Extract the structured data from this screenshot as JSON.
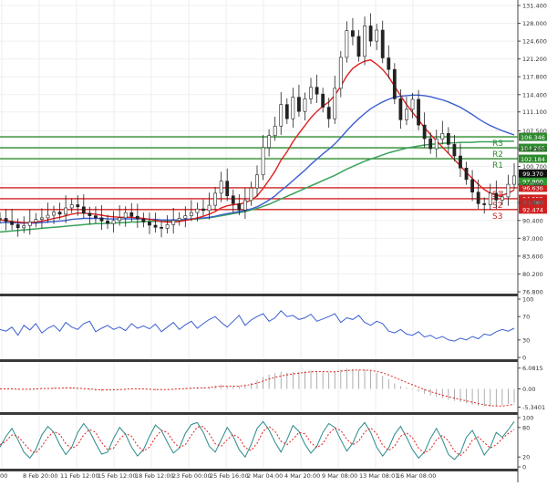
{
  "chart_data": {
    "type": "line",
    "price_axis": {
      "ticks": [
        "131.400",
        "128.000",
        "124.600",
        "121.200",
        "117.800",
        "114.400",
        "111.100",
        "107.500",
        "104.000",
        "100.700",
        "97.300",
        "93.800",
        "90.400",
        "87.000",
        "83.600",
        "80.200",
        "76.800"
      ],
      "tick_values": [
        131.4,
        128.0,
        124.6,
        121.2,
        117.8,
        114.4,
        111.1,
        107.5,
        104.0,
        100.7,
        97.3,
        93.8,
        90.4,
        87.0,
        83.6,
        80.2,
        76.8
      ],
      "ylim": [
        76.8,
        131.4
      ]
    },
    "time_axis": {
      "ticks": [
        "00",
        "8 Feb 20:00",
        "11 Feb 12:00",
        "15 Feb 12:00",
        "18 Feb 12:00",
        "23 Feb 00:00",
        "25 Feb 16:00",
        "2 Mar 04:00",
        "4 Mar 20:00",
        "9 Mar 08:00",
        "13 Mar 08:01",
        "16 Mar 08:00"
      ]
    },
    "levels": {
      "resistance": [
        {
          "label": "R3",
          "value": 106.346,
          "value_text": "106.346"
        },
        {
          "label": "R2",
          "value": 104.265,
          "value_text": "104.265"
        },
        {
          "label": "R1",
          "value": 102.184,
          "value_text": "102.184"
        }
      ],
      "support": [
        {
          "label": "S1",
          "value": 96.636,
          "value_text": "96.636"
        },
        {
          "label": "S2",
          "value": 94.555,
          "value_text": "94.555"
        },
        {
          "label": "S3",
          "value": 92.474,
          "value_text": "92.474"
        }
      ],
      "other_labels": [
        {
          "value": 98.0,
          "value_text": "98.370",
          "color": "#1f4fd6"
        },
        {
          "value": 93.9,
          "value_text": "93.880",
          "color": "#cc2020"
        },
        {
          "value": 97.9,
          "value_text": "97.900",
          "color": "#2f9a2f"
        }
      ],
      "current_price": {
        "value": 99.37,
        "value_text": "99.370"
      }
    },
    "price_series": {
      "close": [
        90.8,
        90.2,
        89.6,
        89.0,
        89.4,
        90.1,
        90.6,
        90.9,
        91.4,
        92.0,
        91.6,
        92.8,
        93.4,
        93.0,
        91.8,
        91.3,
        90.9,
        90.3,
        89.8,
        90.4,
        90.9,
        91.9,
        91.2,
        90.7,
        90.1,
        89.5,
        89.1,
        88.9,
        89.6,
        90.4,
        90.8,
        91.3,
        91.9,
        92.6,
        92.3,
        93.3,
        95.6,
        97.9,
        95.1,
        93.6,
        92.4,
        94.2,
        96.6,
        99.1,
        104.3,
        106.6,
        108.4,
        112.5,
        109.8,
        113.9,
        111.2,
        113.6,
        115.8,
        114.5,
        112.0,
        109.8,
        115.6,
        121.5,
        126.6,
        125.5,
        121.7,
        127.5,
        124.6,
        126.7,
        121.4,
        119.2,
        113.6,
        109.6,
        111.6,
        113.5,
        108.6,
        106.0,
        104.1,
        105.9,
        107.0,
        104.9,
        102.7,
        100.4,
        98.2,
        95.8,
        93.6,
        93.4,
        95.6,
        94.3,
        94.9,
        97.3,
        98.9
      ],
      "ma_fast_red": [
        90.5,
        90.4,
        90.2,
        90.1,
        90.0,
        90.0,
        90.1,
        90.3,
        90.5,
        90.8,
        91.0,
        91.3,
        91.6,
        91.8,
        91.8,
        91.7,
        91.6,
        91.4,
        91.2,
        91.1,
        91.0,
        91.0,
        91.0,
        90.9,
        90.8,
        90.6,
        90.4,
        90.2,
        90.1,
        90.1,
        90.2,
        90.4,
        90.6,
        90.9,
        91.2,
        91.6,
        92.1,
        92.8,
        93.2,
        93.4,
        93.5,
        93.8,
        94.3,
        95.1,
        96.5,
        98.1,
        99.8,
        101.9,
        103.5,
        105.4,
        107.0,
        108.5,
        110.0,
        111.2,
        112.2,
        113.0,
        114.3,
        116.0,
        118.0,
        119.4,
        120.2,
        120.8,
        121.0,
        120.2,
        119.2,
        117.8,
        116.0,
        114.2,
        112.5,
        111.0,
        109.6,
        108.1,
        106.8,
        105.6,
        104.4,
        103.2,
        102.0,
        100.8,
        99.6,
        98.4,
        97.3,
        96.3,
        95.6,
        95.2,
        95.2,
        95.6,
        96.2
      ],
      "ma_mid_blue": [
        90.0,
        90.0,
        90.0,
        89.9,
        89.9,
        89.9,
        89.9,
        90.0,
        90.1,
        90.2,
        90.3,
        90.4,
        90.6,
        90.7,
        90.8,
        90.8,
        90.8,
        90.8,
        90.7,
        90.7,
        90.7,
        90.7,
        90.7,
        90.7,
        90.7,
        90.6,
        90.6,
        90.5,
        90.5,
        90.5,
        90.5,
        90.6,
        90.7,
        90.8,
        90.9,
        91.0,
        91.2,
        91.5,
        91.7,
        91.9,
        92.1,
        92.3,
        92.6,
        93.0,
        93.6,
        94.3,
        95.1,
        96.1,
        97.0,
        98.0,
        99.0,
        100.0,
        101.1,
        102.1,
        103.1,
        104.0,
        105.0,
        106.2,
        107.5,
        108.7,
        109.8,
        110.8,
        111.7,
        112.4,
        113.0,
        113.5,
        113.9,
        114.1,
        114.2,
        114.3,
        114.3,
        114.2,
        114.0,
        113.7,
        113.4,
        113.0,
        112.5,
        112.0,
        111.3,
        110.6,
        109.8,
        109.1,
        108.5,
        108.0,
        107.5,
        107.1,
        106.7
      ],
      "ma_slow_green": [
        88.2,
        88.3,
        88.4,
        88.5,
        88.6,
        88.7,
        88.8,
        88.9,
        89.0,
        89.1,
        89.2,
        89.3,
        89.4,
        89.5,
        89.6,
        89.7,
        89.8,
        89.8,
        89.9,
        89.9,
        90.0,
        90.0,
        90.1,
        90.1,
        90.2,
        90.2,
        90.2,
        90.3,
        90.3,
        90.4,
        90.4,
        90.5,
        90.6,
        90.7,
        90.8,
        90.9,
        91.1,
        91.3,
        91.5,
        91.7,
        91.9,
        92.1,
        92.4,
        92.7,
        93.1,
        93.5,
        94.0,
        94.5,
        95.0,
        95.5,
        96.0,
        96.5,
        97.0,
        97.5,
        98.0,
        98.5,
        99.0,
        99.6,
        100.2,
        100.7,
        101.2,
        101.7,
        102.1,
        102.5,
        102.9,
        103.3,
        103.6,
        103.9,
        104.2,
        104.4,
        104.6,
        104.8,
        104.9,
        105.0,
        105.1,
        105.2,
        105.2,
        105.3,
        105.3,
        105.3,
        105.4,
        105.4,
        105.4,
        105.4,
        105.5,
        105.5,
        105.5
      ]
    },
    "rsi": {
      "ticks": [
        "100",
        "70",
        "30",
        "0"
      ],
      "tick_values": [
        100,
        70,
        30,
        0
      ],
      "values": [
        48,
        45,
        52,
        38,
        55,
        47,
        58,
        42,
        50,
        55,
        45,
        60,
        52,
        48,
        58,
        62,
        44,
        50,
        55,
        48,
        52,
        46,
        58,
        50,
        54,
        49,
        57,
        44,
        52,
        60,
        48,
        56,
        62,
        50,
        58,
        65,
        70,
        60,
        52,
        62,
        72,
        55,
        64,
        70,
        75,
        62,
        68,
        80,
        70,
        72,
        65,
        68,
        74,
        62,
        66,
        70,
        75,
        60,
        68,
        65,
        72,
        60,
        55,
        62,
        58,
        45,
        42,
        48,
        40,
        38,
        44,
        35,
        38,
        32,
        36,
        30,
        28,
        33,
        30,
        36,
        32,
        40,
        38,
        44,
        48,
        45,
        50
      ],
      "ylim": [
        0,
        100
      ]
    },
    "macd": {
      "ticks": [
        "6.0815",
        "0.00",
        "-5.3401"
      ],
      "tick_values": [
        6.0815,
        0.0,
        -5.3401
      ],
      "hist": [
        0.0,
        0.1,
        -0.2,
        -0.3,
        -0.2,
        -0.1,
        0.1,
        0.3,
        0.2,
        0.4,
        0.2,
        0.5,
        0.4,
        0.1,
        -0.2,
        -0.4,
        -0.5,
        -0.6,
        -0.4,
        -0.3,
        -0.1,
        0.1,
        0.2,
        0.1,
        -0.1,
        -0.2,
        -0.4,
        -0.3,
        -0.1,
        0.1,
        0.2,
        0.3,
        0.4,
        0.5,
        0.4,
        0.6,
        1.0,
        1.2,
        0.9,
        0.8,
        0.9,
        1.3,
        1.8,
        2.5,
        3.5,
        4.2,
        4.6,
        5.0,
        4.8,
        4.9,
        5.0,
        5.2,
        5.4,
        5.2,
        5.0,
        4.8,
        5.2,
        5.6,
        5.9,
        5.8,
        5.5,
        5.6,
        5.2,
        4.6,
        3.8,
        2.8,
        1.6,
        0.8,
        0.3,
        -0.2,
        -0.8,
        -1.4,
        -1.9,
        -2.3,
        -2.7,
        -3.1,
        -3.5,
        -3.9,
        -4.2,
        -4.6,
        -4.9,
        -5.1,
        -5.2,
        -5.0,
        -4.8,
        -4.4,
        -4.0
      ],
      "signal": [
        0.0,
        0.0,
        0.0,
        -0.1,
        -0.1,
        -0.1,
        0.0,
        0.1,
        0.1,
        0.2,
        0.2,
        0.3,
        0.3,
        0.2,
        0.1,
        0.0,
        -0.2,
        -0.3,
        -0.3,
        -0.3,
        -0.2,
        -0.1,
        0.0,
        0.0,
        0.0,
        -0.1,
        -0.2,
        -0.2,
        -0.2,
        -0.1,
        0.0,
        0.1,
        0.2,
        0.3,
        0.3,
        0.4,
        0.6,
        0.8,
        0.8,
        0.8,
        0.8,
        1.0,
        1.3,
        1.7,
        2.3,
        2.9,
        3.4,
        3.8,
        4.1,
        4.4,
        4.6,
        4.8,
        5.0,
        5.1,
        5.1,
        5.0,
        5.0,
        5.2,
        5.4,
        5.5,
        5.5,
        5.5,
        5.4,
        5.1,
        4.7,
        4.1,
        3.4,
        2.6,
        1.9,
        1.2,
        0.5,
        -0.2,
        -0.8,
        -1.3,
        -1.8,
        -2.3,
        -2.7,
        -3.1,
        -3.5,
        -3.9,
        -4.3,
        -4.6,
        -4.9,
        -5.0,
        -5.0,
        -4.8,
        -4.5
      ],
      "ylim": [
        -6.0,
        6.8
      ]
    },
    "stochastic": {
      "ticks": [
        "100",
        "80",
        "20",
        "0"
      ],
      "tick_values": [
        100,
        80,
        20,
        0
      ],
      "k": [
        40,
        62,
        78,
        55,
        30,
        18,
        35,
        65,
        82,
        70,
        45,
        25,
        40,
        70,
        88,
        72,
        48,
        26,
        30,
        58,
        80,
        66,
        40,
        22,
        35,
        62,
        85,
        74,
        50,
        28,
        38,
        68,
        86,
        90,
        70,
        42,
        30,
        55,
        80,
        62,
        35,
        20,
        45,
        78,
        92,
        75,
        50,
        30,
        55,
        84,
        72,
        46,
        28,
        42,
        70,
        88,
        80,
        55,
        32,
        48,
        76,
        90,
        70,
        40,
        22,
        38,
        66,
        82,
        60,
        35,
        18,
        30,
        58,
        78,
        55,
        25,
        15,
        28,
        60,
        74,
        50,
        24,
        40,
        70,
        60,
        75,
        92
      ],
      "d": [
        45,
        52,
        65,
        62,
        48,
        34,
        28,
        42,
        60,
        72,
        66,
        47,
        37,
        45,
        65,
        76,
        70,
        49,
        35,
        38,
        56,
        68,
        62,
        43,
        32,
        40,
        60,
        74,
        70,
        51,
        39,
        45,
        64,
        81,
        82,
        67,
        47,
        42,
        55,
        66,
        59,
        39,
        33,
        48,
        72,
        82,
        72,
        52,
        45,
        56,
        70,
        67,
        49,
        39,
        47,
        67,
        79,
        74,
        56,
        45,
        52,
        71,
        79,
        67,
        44,
        33,
        42,
        62,
        69,
        59,
        38,
        28,
        36,
        55,
        64,
        53,
        32,
        23,
        34,
        54,
        61,
        49,
        38,
        45,
        57,
        68,
        76
      ]
    }
  }
}
